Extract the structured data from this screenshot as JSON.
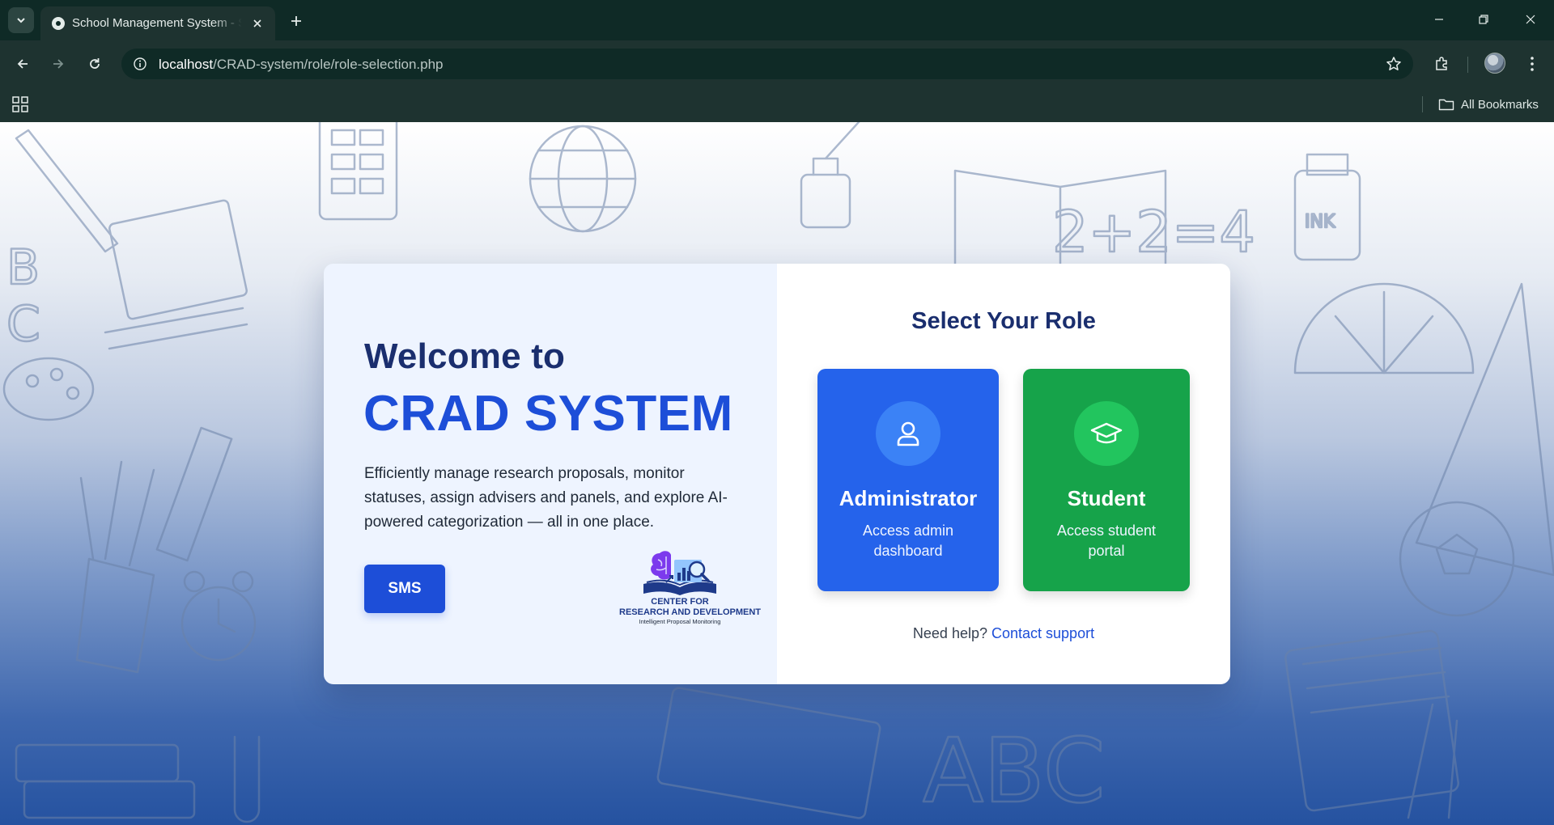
{
  "browser": {
    "tab_title": "School Management System - S",
    "url_host": "localhost",
    "url_path": "/CRAD-system/role/role-selection.php",
    "bookmarks_label": "All Bookmarks",
    "icons": [
      "tab-search-icon",
      "favicon-icon",
      "close-icon",
      "plus-icon",
      "minimize-icon",
      "restore-icon",
      "window-close-icon",
      "back-arrow-icon",
      "forward-arrow-icon",
      "reload-icon",
      "site-info-icon",
      "star-icon",
      "extensions-icon",
      "kebab-menu-icon",
      "apps-grid-icon",
      "folder-icon"
    ]
  },
  "hero": {
    "welcome": "Welcome to",
    "brand": "CRAD SYSTEM",
    "description": "Efficiently manage research proposals, monitor statuses, assign advisers and panels, and explore AI-powered categorization — all in one place.",
    "sms_button": "SMS",
    "logo": {
      "line1": "CENTER FOR",
      "line2": "RESEARCH AND DEVELOPMENT",
      "line3": "Intelligent Proposal Monitoring"
    }
  },
  "roles": {
    "title": "Select Your Role",
    "admin": {
      "name": "Administrator",
      "description": "Access admin dashboard",
      "icon": "user-icon"
    },
    "student": {
      "name": "Student",
      "description": "Access student portal",
      "icon": "graduation-cap-icon"
    },
    "help_text": "Need help?",
    "help_link": "Contact support"
  },
  "colors": {
    "primary": "#1d4ed8",
    "admin_card": "#2563eb",
    "student_card": "#16a34a",
    "heading": "#1a2e6e",
    "chrome": "#1e3330"
  }
}
